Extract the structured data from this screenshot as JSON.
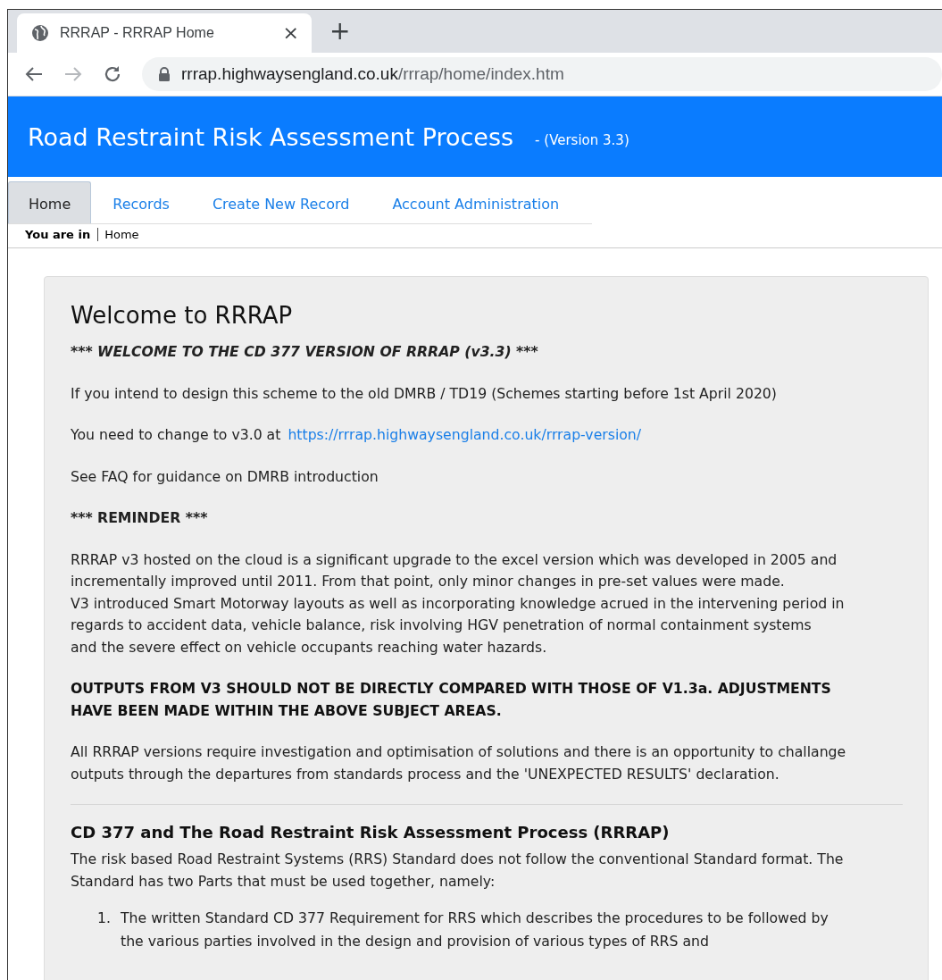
{
  "browser": {
    "tab_title": "RRRAP - RRRAP Home",
    "close": "×",
    "new_tab": "+",
    "url_host": "rrrap.highwaysengland.co.uk",
    "url_path": "/rrrap/home/index.htm"
  },
  "header": {
    "title": "Road Restraint Risk Assessment Process",
    "version": "- (Version 3.3)"
  },
  "nav": [
    {
      "label": "Home",
      "selected": true
    },
    {
      "label": "Records",
      "selected": false
    },
    {
      "label": "Create New Record",
      "selected": false
    },
    {
      "label": "Account Administration",
      "selected": false
    }
  ],
  "breadcrumb": {
    "label": "You are in",
    "current": "Home"
  },
  "panel": {
    "title": "Welcome to RRRAP",
    "blocks": [
      {
        "kind": "banner",
        "lead": "***",
        "text": "WELCOME TO THE CD 377 VERSION OF RRRAP (v3.3)",
        "trail": "***",
        "italic": true
      },
      {
        "kind": "text",
        "lines": [
          "If you intend to design this scheme to the old DMRB / TD19 (Schemes starting before 1st April 2020)"
        ],
        "bold": false
      },
      {
        "kind": "link",
        "text": "You need to change to v3.0 at",
        "link": "https://rrrap.highwaysengland.co.uk/rrrap-version/"
      },
      {
        "kind": "text",
        "lines": [
          "See FAQ for guidance on DMRB introduction"
        ],
        "bold": false
      },
      {
        "kind": "banner",
        "lead": "***",
        "text": "REMINDER",
        "trail": "***",
        "italic": false
      },
      {
        "kind": "text",
        "lines": [
          "RRRAP v3 hosted on the cloud is a significant upgrade to the excel version which was developed in 2005 and",
          "incrementally improved until 2011. From that point, only minor changes in pre-set values were made.",
          "V3 introduced Smart Motorway layouts as well as incorporating knowledge acrued in the intervening period in",
          "regards to accident data, vehicle balance, risk involving HGV penetration of normal containment systems",
          "and the severe effect on vehicle occupants reaching water hazards."
        ],
        "bold": false
      },
      {
        "kind": "text",
        "lines": [
          "OUTPUTS FROM V3 SHOULD NOT BE DIRECTLY COMPARED WITH THOSE OF V1.3a. ADJUSTMENTS",
          "HAVE BEEN MADE WITHIN THE ABOVE SUBJECT AREAS."
        ],
        "bold": true
      },
      {
        "kind": "text",
        "lines": [
          "All RRRAP versions require investigation and optimisation of solutions and there is an opportunity to challange",
          "outputs through the departures from standards process and the 'UNEXPECTED RESULTS' declaration."
        ],
        "bold": false
      },
      {
        "kind": "rule"
      },
      {
        "kind": "heading",
        "text": "CD 377 and The Road Restraint Risk Assessment Process (RRRAP)"
      },
      {
        "kind": "text",
        "lines": [
          "The risk based Road Restraint Systems (RRS) Standard does not follow the conventional Standard format. The",
          "Standard has two Parts that must be used together, namely:"
        ],
        "bold": false
      },
      {
        "kind": "list",
        "items": [
          {
            "number": "1.",
            "lines": [
              "The written Standard CD 377 Requirement for RRS which describes the procedures to be followed by",
              "the various parties involved in the design and provision of various types of RRS and"
            ]
          }
        ]
      }
    ]
  }
}
